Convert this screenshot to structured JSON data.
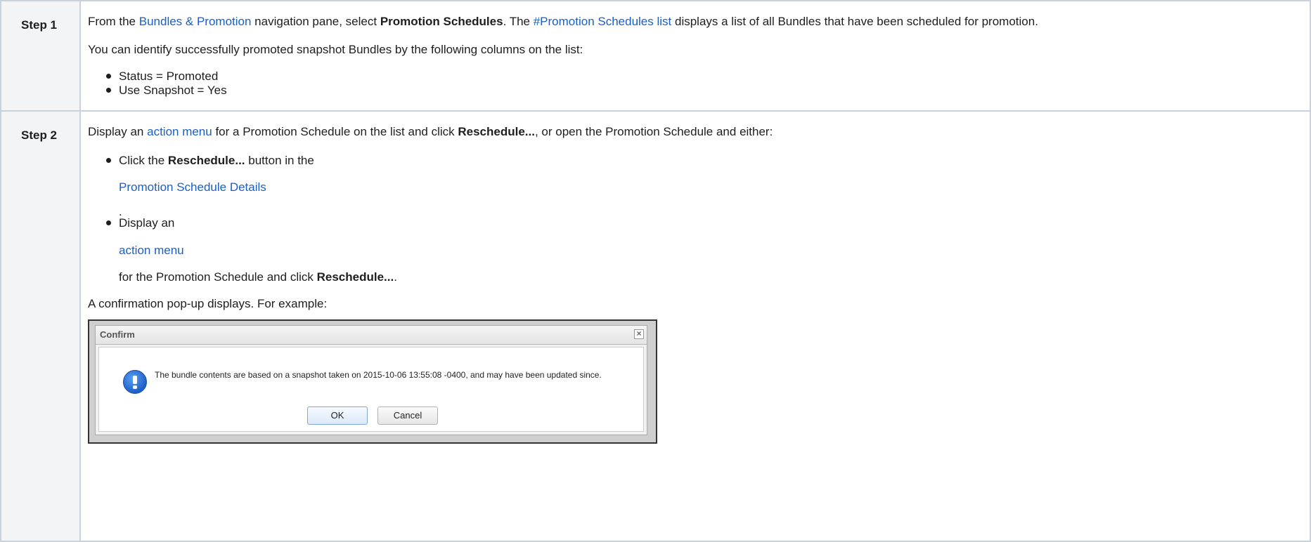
{
  "step1": {
    "label": "Step 1",
    "intro": {
      "text1": "From the ",
      "link1": "Bundles & Promotion",
      "text2": " navigation pane, select ",
      "bold1": "Promotion Schedules",
      "text3": ". The ",
      "link2": "#Promotion Schedules list",
      "text4": " displays a list of all Bundles that have been scheduled for promotion."
    },
    "identify": "You can identify successfully promoted snapshot Bundles by the following columns on the list:",
    "bullets": [
      "Status = Promoted",
      "Use Snapshot = Yes"
    ]
  },
  "step2": {
    "label": "Step 2",
    "intro": {
      "text1": "Display an ",
      "link1": "action menu",
      "text2": " for a Promotion Schedule on the list and click ",
      "bold1": "Reschedule...",
      "text3": ", or open the Promotion Schedule and either:"
    },
    "bullet1": {
      "text1": "Click the ",
      "bold1": "Reschedule...",
      "text2": " button in the",
      "link": "Promotion Schedule Details",
      "trail": "."
    },
    "bullet2": {
      "text1": "Display an",
      "link": "action menu",
      "text2": "for the Promotion Schedule and click ",
      "bold1": "Reschedule...",
      "trail": "."
    },
    "popup_intro": "A confirmation pop-up displays. For example:"
  },
  "dialog": {
    "title": "Confirm",
    "close": "×",
    "message": "The bundle contents are based on a snapshot taken on 2015-10-06 13:55:08 -0400, and may have been updated since.",
    "ok": "OK",
    "cancel": "Cancel"
  }
}
